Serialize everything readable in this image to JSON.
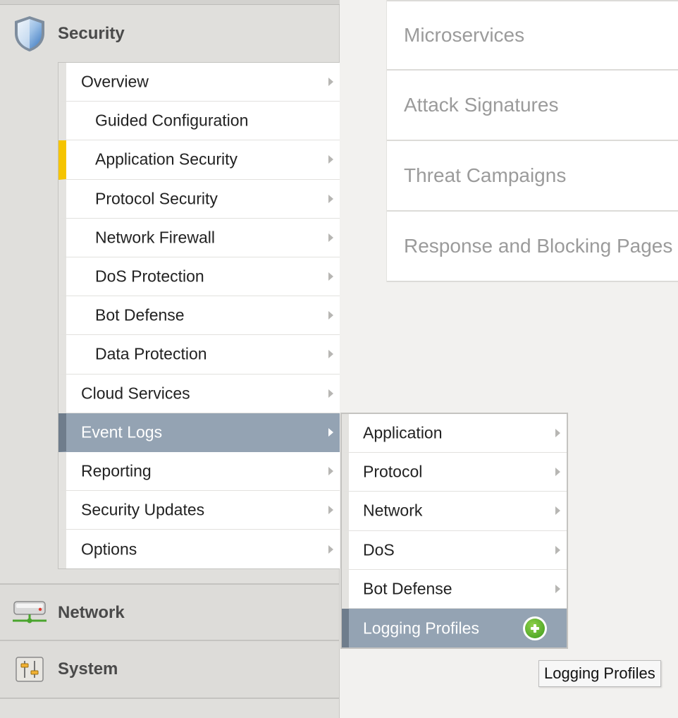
{
  "sidebar": {
    "sections": {
      "security": {
        "label": "Security",
        "icon": "shield-icon"
      },
      "network": {
        "label": "Network",
        "icon": "network-device-icon"
      },
      "system": {
        "label": "System",
        "icon": "sliders-icon"
      }
    },
    "security_menu": [
      {
        "label": "Overview",
        "level": 1,
        "has_submenu": true
      },
      {
        "label": "Guided Configuration",
        "level": 2,
        "has_submenu": false
      },
      {
        "label": "Application Security",
        "level": 2,
        "has_submenu": true,
        "accent": "#f5c400"
      },
      {
        "label": "Protocol Security",
        "level": 2,
        "has_submenu": true
      },
      {
        "label": "Network Firewall",
        "level": 2,
        "has_submenu": true
      },
      {
        "label": "DoS Protection",
        "level": 2,
        "has_submenu": true
      },
      {
        "label": "Bot Defense",
        "level": 2,
        "has_submenu": true
      },
      {
        "label": "Data Protection",
        "level": 2,
        "has_submenu": true
      },
      {
        "label": "Cloud Services",
        "level": 1,
        "has_submenu": true
      },
      {
        "label": "Event Logs",
        "level": 1,
        "has_submenu": true,
        "selected": true
      },
      {
        "label": "Reporting",
        "level": 1,
        "has_submenu": true
      },
      {
        "label": "Security Updates",
        "level": 1,
        "has_submenu": true
      },
      {
        "label": "Options",
        "level": 1,
        "has_submenu": true
      }
    ]
  },
  "event_logs_flyout": [
    {
      "label": "Application",
      "has_submenu": true
    },
    {
      "label": "Protocol",
      "has_submenu": true
    },
    {
      "label": "Network",
      "has_submenu": true
    },
    {
      "label": "DoS",
      "has_submenu": true
    },
    {
      "label": "Bot Defense",
      "has_submenu": true
    },
    {
      "label": "Logging Profiles",
      "has_submenu": false,
      "selected": true,
      "action_icon": "add-circle-icon"
    }
  ],
  "content_list": [
    {
      "label": "Microservices"
    },
    {
      "label": "Attack Signatures"
    },
    {
      "label": "Threat Campaigns"
    },
    {
      "label": "Response and Blocking Pages"
    }
  ],
  "tooltip": {
    "text": "Logging Profiles"
  },
  "colors": {
    "selected_bg": "#94a3b3",
    "accent_yellow": "#f5c400",
    "add_icon_green": "#4caf28",
    "panel_bg": "#e0dfdc"
  }
}
